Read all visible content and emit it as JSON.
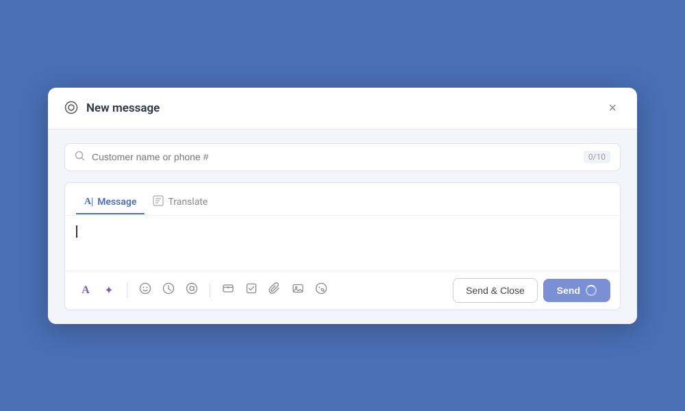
{
  "modal": {
    "title": "New message",
    "close_label": "×"
  },
  "search": {
    "placeholder": "Customer name or phone #",
    "count": "0/10"
  },
  "tabs": [
    {
      "id": "message",
      "label": "Message",
      "active": true
    },
    {
      "id": "translate",
      "label": "Translate",
      "active": false
    }
  ],
  "editor": {
    "content": ""
  },
  "toolbar": {
    "icons": [
      {
        "id": "text-format",
        "symbol": "A",
        "title": "Text format"
      },
      {
        "id": "sparkle",
        "symbol": "✦",
        "title": "AI sparkle"
      },
      {
        "id": "emoji",
        "symbol": "☺",
        "title": "Emoji"
      },
      {
        "id": "clock",
        "symbol": "⊕",
        "title": "Scheduled"
      },
      {
        "id": "mention",
        "symbol": "◎",
        "title": "Mention"
      },
      {
        "id": "dollar",
        "symbol": "⊞",
        "title": "Payment"
      },
      {
        "id": "checkbox",
        "symbol": "☑",
        "title": "Checklist"
      },
      {
        "id": "attach",
        "symbol": "⊘",
        "title": "Attach"
      },
      {
        "id": "image",
        "symbol": "⊟",
        "title": "Image"
      },
      {
        "id": "heart",
        "symbol": "♡",
        "title": "Sticker"
      }
    ]
  },
  "buttons": {
    "send_close": "Send & Close",
    "send": "Send"
  },
  "colors": {
    "background": "#4a6fb5",
    "accent": "#7b8fd4",
    "tab_active": "#4a6fb5"
  }
}
